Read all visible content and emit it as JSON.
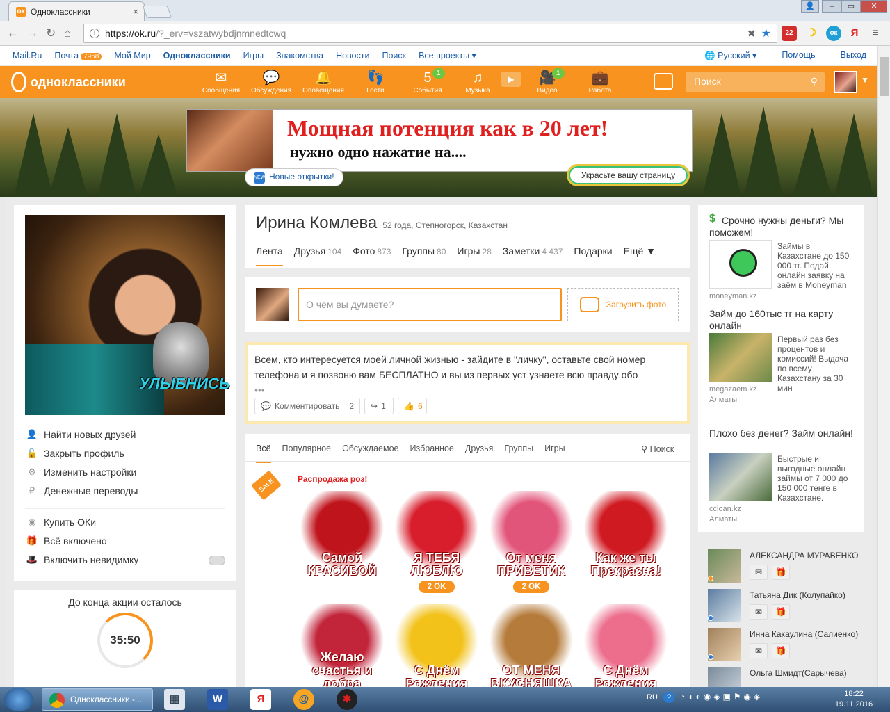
{
  "browser": {
    "tab_title": "Одноклассники",
    "url_host": "https://ok.ru",
    "url_rest": "/?_erv=vszatwybdjnmnedtcwq",
    "ext_badge": "22",
    "win_min": "–",
    "win_max": "▭",
    "win_close": "✕"
  },
  "toplinks": {
    "items": [
      "Mail.Ru",
      "Почта",
      "Мой Мир",
      "Одноклассники",
      "Игры",
      "Знакомства",
      "Новости",
      "Поиск",
      "Все проекты ▾"
    ],
    "mail_count": "7958",
    "lang": "Русский ▾",
    "help": "Помощь",
    "logout": "Выход"
  },
  "okbar": {
    "logo": "одноклассники",
    "nav": [
      {
        "label": "Сообщения",
        "icon": "envelope-icon",
        "glyph": "✉"
      },
      {
        "label": "Обсуждения",
        "icon": "chat-icon",
        "glyph": "💬"
      },
      {
        "label": "Оповещения",
        "icon": "bell-icon",
        "glyph": "🔔"
      },
      {
        "label": "Гости",
        "icon": "footprints-icon",
        "glyph": "👣"
      },
      {
        "label": "События",
        "icon": "events-icon",
        "glyph": "5",
        "count": "1"
      },
      {
        "label": "Музыка",
        "icon": "music-icon",
        "glyph": "♫"
      },
      {
        "label": "",
        "icon": "video-play-icon",
        "glyph": "▶"
      },
      {
        "label": "Видео",
        "icon": "camera-icon",
        "glyph": "🎥",
        "count": "1"
      },
      {
        "label": "Работа",
        "icon": "briefcase-icon",
        "glyph": "💼"
      }
    ],
    "search_placeholder": "Поиск"
  },
  "banner": {
    "ad_line1": "Мощная потенция как в 20 лет!",
    "ad_line2": "нужно одно нажатие на....",
    "new_cards": "Новые открытки!",
    "new_badge": "NEW",
    "decorate": "Украсьте вашу страницу"
  },
  "left": {
    "photo_caption": "УЛЫБНИСЬ",
    "menu": [
      {
        "label": "Найти новых друзей",
        "icon": "person-icon",
        "glyph": "👤"
      },
      {
        "label": "Закрыть профиль",
        "icon": "lock-icon",
        "glyph": "🔓"
      },
      {
        "label": "Изменить настройки",
        "icon": "gear-icon",
        "glyph": "⚙"
      },
      {
        "label": "Денежные переводы",
        "icon": "money-icon",
        "glyph": "₽"
      },
      {
        "label": "Купить ОКи",
        "icon": "ok-coin-icon",
        "glyph": "◉"
      },
      {
        "label": "Всё включено",
        "icon": "gift-icon",
        "glyph": "🎁"
      },
      {
        "label": "Включить невидимку",
        "icon": "hat-icon",
        "glyph": "🎩"
      }
    ],
    "timer_label": "До конца акции осталось",
    "timer_value": "35:50"
  },
  "profile": {
    "name": "Ирина Комлева",
    "meta": "52 года, Степногорск, Казахстан",
    "tabs": [
      {
        "label": "Лента",
        "count": ""
      },
      {
        "label": "Друзья",
        "count": "104"
      },
      {
        "label": "Фото",
        "count": "873"
      },
      {
        "label": "Группы",
        "count": "80"
      },
      {
        "label": "Игры",
        "count": "28"
      },
      {
        "label": "Заметки",
        "count": "4 437"
      },
      {
        "label": "Подарки",
        "count": ""
      },
      {
        "label": "Ещё ▼",
        "count": ""
      }
    ]
  },
  "post": {
    "placeholder": "О чём вы думаете?",
    "upload": "Загрузить фото"
  },
  "status": {
    "text": "Всем, кто интересуется моей личной жизнью - зайдите в \"личку\", оставьте свой номер телефона и я позвоню вам БЕСПЛАТНО и вы из первых уст узнаете всю правду обо",
    "more": "•••",
    "comment": "Комментировать",
    "comment_count": "2",
    "share_count": "1",
    "like_count": "6"
  },
  "feed": {
    "tabs": [
      "Всё",
      "Популярное",
      "Обсуждаемое",
      "Избранное",
      "Друзья",
      "Группы",
      "Игры"
    ],
    "search": "Поиск",
    "sale_badge": "SALE",
    "sale_title": "Распродажа роз!",
    "gifts": [
      {
        "caption": "Самой КРАСИВОЙ",
        "price": "",
        "color": "#c0141c"
      },
      {
        "caption": "Я ТЕБЯ ЛЮБЛЮ",
        "price": "2 OK",
        "color": "#d81d2c"
      },
      {
        "caption": "От меня ПРИВЕТИК",
        "price": "2 OK",
        "color": "#e2557a"
      },
      {
        "caption": "Как же ты Прекрасна!",
        "price": "",
        "color": "#d01a22"
      },
      {
        "caption": "Желаю счастья и добра",
        "price": "",
        "color": "#c2243a"
      },
      {
        "caption": "С Днём Рождения",
        "price": "",
        "color": "#f2c21b"
      },
      {
        "caption": "ОТ МЕНЯ ВКУСНЯШКА",
        "price": "",
        "color": "#b57b3b"
      },
      {
        "caption": "С Днём Рождения",
        "price": "",
        "color": "#ec6d8c"
      }
    ]
  },
  "right": {
    "ads": [
      {
        "title": "Срочно нужны деньги? Мы поможем!",
        "text": "Займы в Казахстане до 150 000 тг. Подай онлайн заявку на заём в Moneyman",
        "src": "moneyman.kz",
        "city": ""
      },
      {
        "title": "Займ до 160тыс тг на карту онлайн",
        "text": "Первый раз без процентов и комиссий! Выдача по всему Казахстану за 30 мин",
        "src": "megazaem.kz",
        "city": "Алматы"
      },
      {
        "title": "Плохо без денег? Займ онлайн!",
        "text": "Быстрые и выгодные онлайн займы от 7 000 до 150 000 тенге в Казахстане.",
        "src": "ccloan.kz",
        "city": "Алматы"
      }
    ],
    "friends": [
      {
        "name": "АЛЕКСАНДРА МУРАВЕНКО",
        "dot": "#f7931e"
      },
      {
        "name": "Татьяна Дик (Колупайко)",
        "dot": "#2b7bd1"
      },
      {
        "name": "Инна Какаулина (Салиенко)",
        "dot": "#2b7bd1"
      },
      {
        "name": "Ольга Шмидт(Сарычева)",
        "dot": ""
      }
    ]
  },
  "taskbar": {
    "chrome_title": "Одноклассники -...",
    "lang": "RU",
    "time": "18:22",
    "date": "19.11.2016"
  }
}
